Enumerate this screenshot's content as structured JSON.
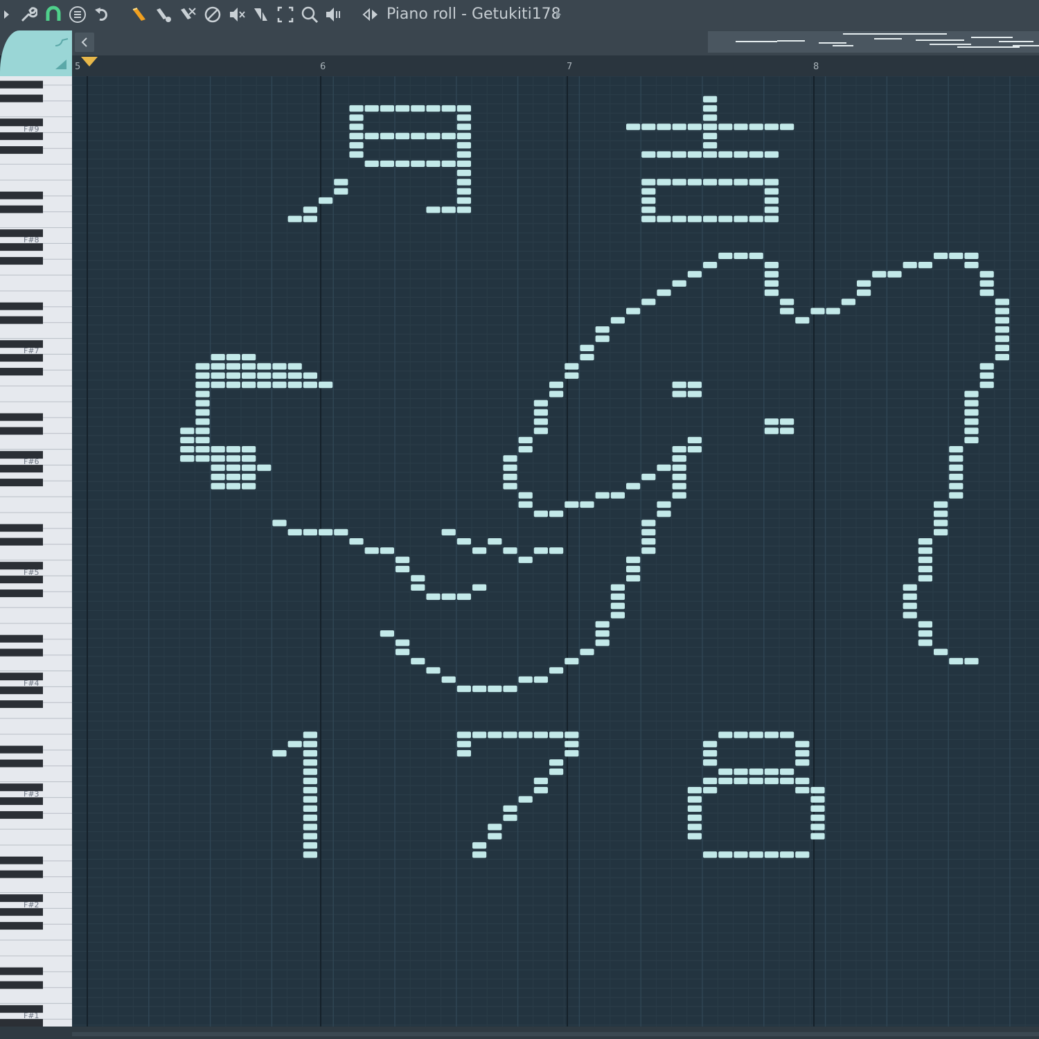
{
  "toolbar": {
    "icons": [
      "play-arrow-icon",
      "wrench-icon",
      "magnet-icon",
      "menu-icon",
      "undo-icon",
      "pencil-icon",
      "paint-icon",
      "delete-icon",
      "mute-icon",
      "slice-icon",
      "select-icon",
      "zoom-icon",
      "playback-icon",
      "speaker-icon"
    ],
    "title": "Piano roll - Getukiti178"
  },
  "ruler": {
    "bars": [
      "5",
      "6",
      "7",
      "8"
    ]
  },
  "keyboard": {
    "labels": [
      "F#9",
      "F#8",
      "F#7",
      "F#6",
      "F#5",
      "F#4",
      "F#3",
      "F#2",
      "F#1"
    ]
  },
  "colors": {
    "note": "#c3e9e9",
    "grid_bg": "#233440",
    "accent_tab": "#9ad6d6",
    "playhead": "#e8b84a"
  },
  "notes_art": {
    "description_text": "",
    "note_count": 1
  }
}
